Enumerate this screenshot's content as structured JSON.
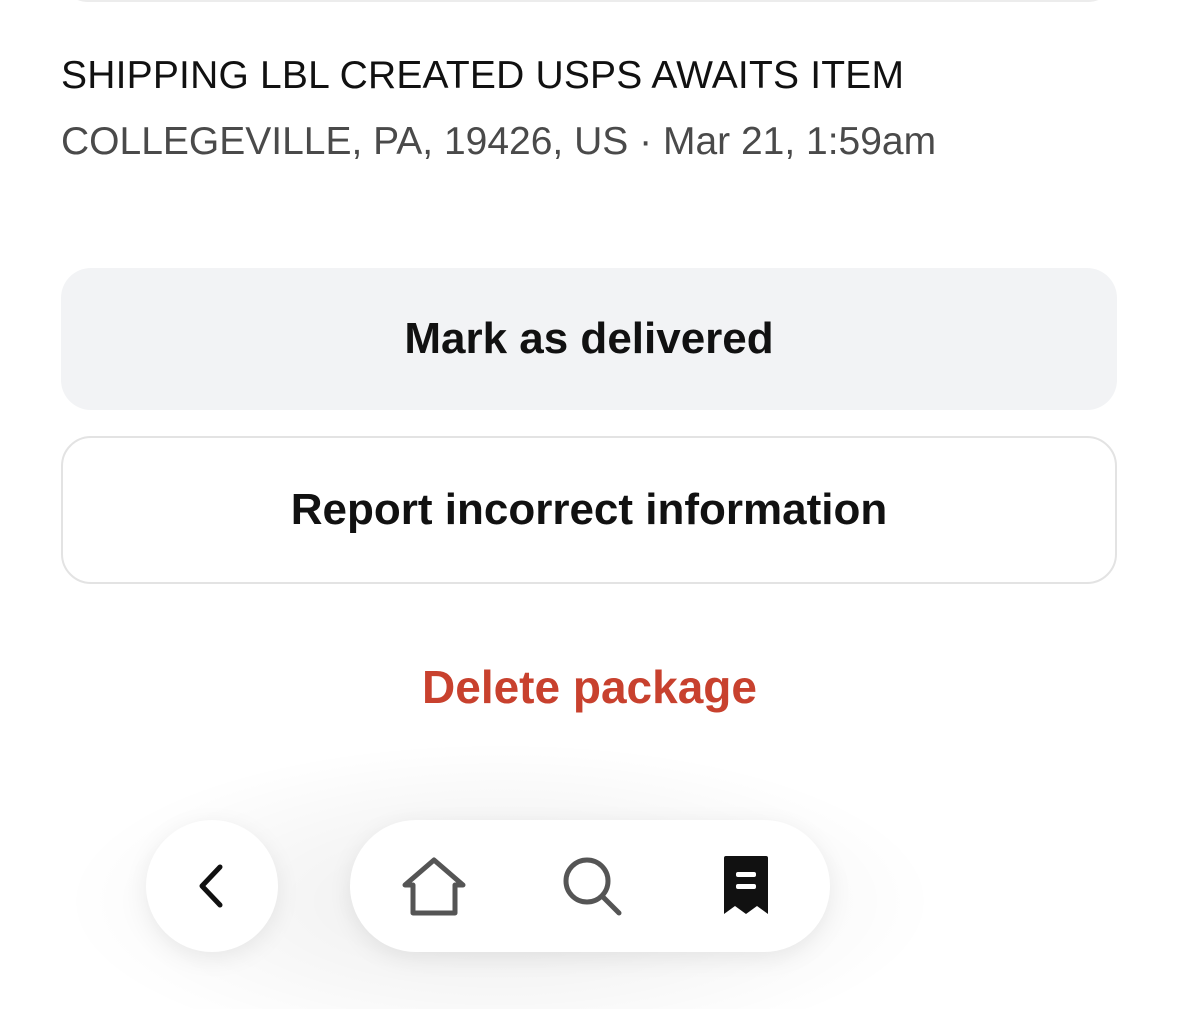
{
  "tracking_event": {
    "status": "SHIPPING LBL CREATED USPS AWAITS ITEM",
    "location": "COLLEGEVILLE, PA, 19426, US",
    "separator": "·",
    "timestamp": "Mar 21, 1:59am"
  },
  "actions": {
    "mark_delivered_label": "Mark as delivered",
    "report_label": "Report incorrect information",
    "delete_label": "Delete package"
  },
  "colors": {
    "delete_red": "#c8412e",
    "primary_button_bg": "#f2f3f5",
    "text_dark": "#111111",
    "text_muted": "#4a4a4a"
  },
  "bottom_nav": {
    "back_icon": "chevron-left-icon",
    "items": [
      {
        "icon": "home-icon"
      },
      {
        "icon": "search-icon"
      },
      {
        "icon": "receipt-icon",
        "active": true
      }
    ]
  }
}
